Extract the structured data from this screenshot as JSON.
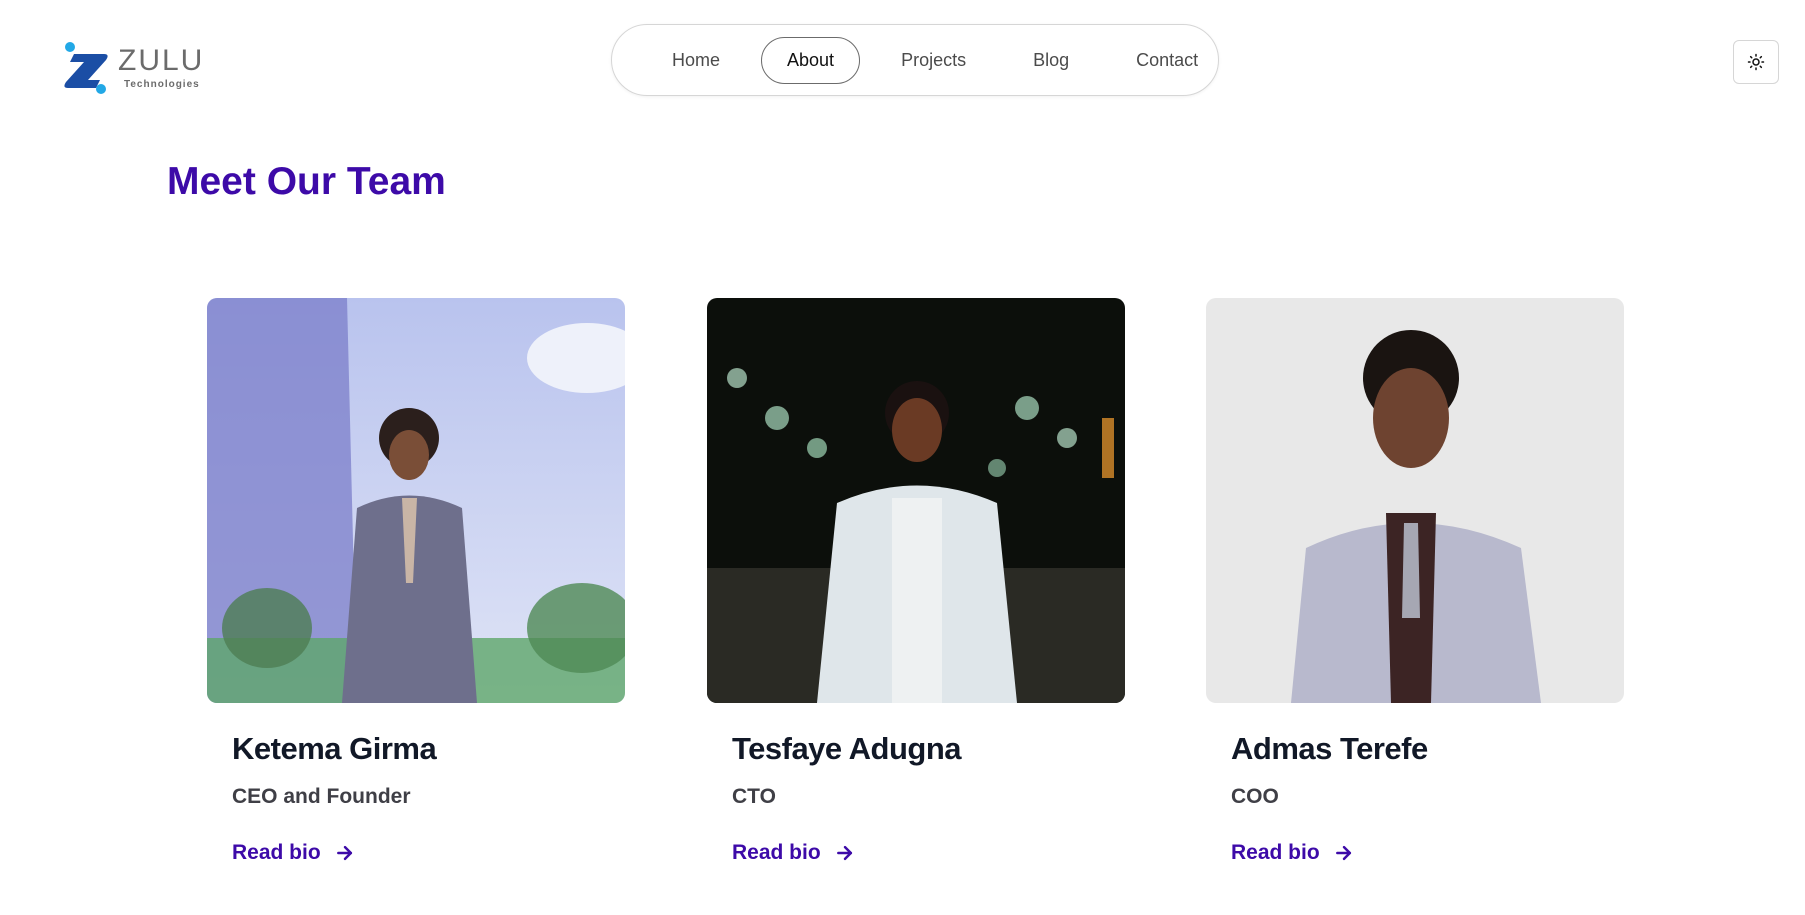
{
  "header": {
    "logo": {
      "name": "ZULU",
      "subtitle": "Technologies",
      "colors": {
        "dark_blue": "#1b4ea5",
        "light_blue": "#22a8e6"
      }
    },
    "nav": {
      "items": [
        {
          "label": "Home",
          "active": false
        },
        {
          "label": "About",
          "active": true
        },
        {
          "label": "Projects",
          "active": false
        },
        {
          "label": "Blog",
          "active": false
        },
        {
          "label": "Contact",
          "active": false
        }
      ]
    },
    "theme_toggle": {
      "icon": "sun-icon"
    }
  },
  "team_section": {
    "title": "Meet Our Team",
    "accent_color": "#3d0aa8",
    "members": [
      {
        "name": "Ketema Girma",
        "role": "CEO and Founder",
        "link_label": "Read bio",
        "link_icon": "arrow-right-icon"
      },
      {
        "name": "Tesfaye Adugna",
        "role": "CTO",
        "link_label": "Read bio",
        "link_icon": "arrow-right-icon"
      },
      {
        "name": "Admas Terefe",
        "role": "COO",
        "link_label": "Read bio",
        "link_icon": "arrow-right-icon"
      }
    ]
  }
}
